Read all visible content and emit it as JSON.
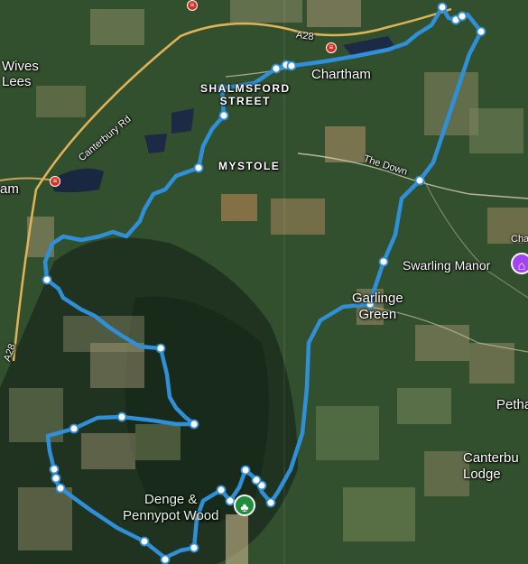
{
  "labels": {
    "wives_lees": "Wives\nLees",
    "am": "am",
    "shalmsford_street": "SHALMSFORD\nSTREET",
    "mystole": "MYSTOLE",
    "chartham": "Chartham",
    "the_down": "The Down",
    "canterbury_rd": "Canterbury Rd",
    "a28_top": "A28",
    "a28_left": "A28",
    "swarling_manor": "Swarling Manor",
    "cha": "Cha",
    "garlinge_green": "Garlinge\nGreen",
    "petham": "Pethan",
    "canterbury_lodge": "Canterbu\nLodge",
    "denge_wood": "Denge &\nPennypot Wood"
  },
  "icons": {
    "rail": "rail-station-icon",
    "manor": "landmark-icon",
    "wood": "park-icon"
  },
  "colors": {
    "route": "#2f8fd8",
    "rail": "#d93025",
    "manor_pin": "#a142f4",
    "wood_pin": "#1e8e3e"
  }
}
